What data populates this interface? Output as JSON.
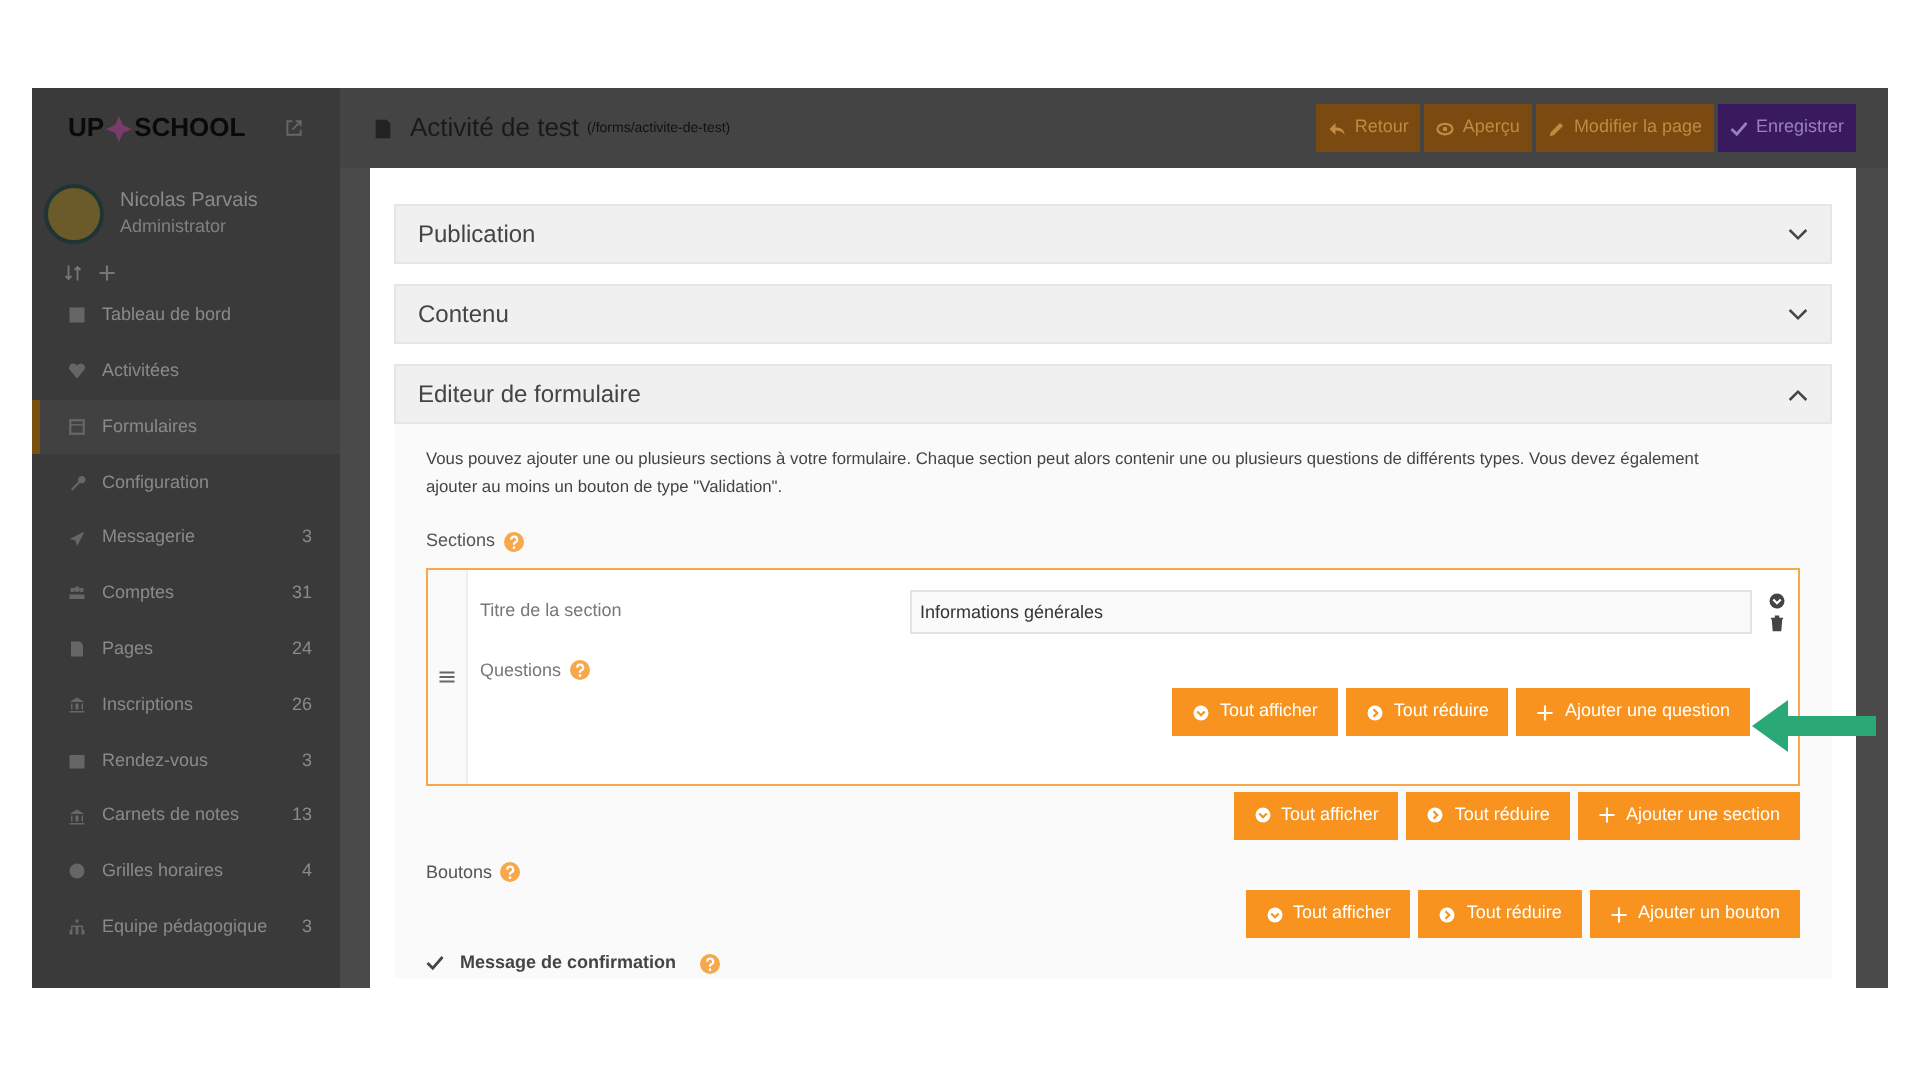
{
  "sidebar": {
    "logo": "UP",
    "logo_rest": "SCHOOL",
    "user": {
      "name": "Nicolas Parvais",
      "role": "Administrator"
    },
    "items": [
      {
        "label": "Tableau de bord",
        "selected": false
      },
      {
        "label": "Activitées",
        "selected": false
      },
      {
        "label": "Formulaires",
        "selected": true
      },
      {
        "label": "Configuration",
        "selected": false
      },
      {
        "label": "Messagerie",
        "selected": false,
        "count": "3"
      },
      {
        "label": "Comptes",
        "selected": false,
        "count": "31"
      },
      {
        "label": "Pages",
        "selected": false,
        "count": "24"
      },
      {
        "label": "Inscriptions",
        "selected": false,
        "count": "26"
      },
      {
        "label": "Rendez-vous",
        "selected": false,
        "count": "3"
      },
      {
        "label": "Carnets de notes",
        "selected": false,
        "count": "13"
      },
      {
        "label": "Grilles horaires",
        "selected": false,
        "count": "4"
      },
      {
        "label": "Equipe pédagogique",
        "selected": false,
        "count": "3"
      }
    ]
  },
  "header": {
    "title": "Activité de test",
    "path": "(/forms/activite-de-test)",
    "buttons": [
      {
        "label": "Retour",
        "kind": "orange"
      },
      {
        "label": "Aperçu",
        "kind": "orange"
      },
      {
        "label": "Modifier la page",
        "kind": "orange"
      },
      {
        "label": "Enregistrer",
        "kind": "purple"
      }
    ]
  },
  "panels": [
    {
      "title": "Publication",
      "expanded": false
    },
    {
      "title": "Contenu",
      "expanded": false
    },
    {
      "title": "Editeur de formulaire",
      "expanded": true
    }
  ],
  "editor": {
    "intro": "Vous pouvez ajouter une ou plusieurs sections à votre formulaire. Chaque section peut alors contenir une ou plusieurs questions de différents types. Vous devez également ajouter au moins un bouton de type \"Validation\".",
    "sections_label": "Sections",
    "section": {
      "title_label": "Titre de la section",
      "title_value": "Informations générales",
      "questions_label": "Questions",
      "buttons": [
        "Tout afficher",
        "Tout réduire",
        "Ajouter une question"
      ]
    },
    "section_buttons": [
      "Tout afficher",
      "Tout réduire",
      "Ajouter une section"
    ],
    "buttons_label": "Boutons",
    "button_buttons": [
      "Tout afficher",
      "Tout réduire",
      "Ajouter un bouton"
    ],
    "confirm_label": "Message de confirmation"
  }
}
